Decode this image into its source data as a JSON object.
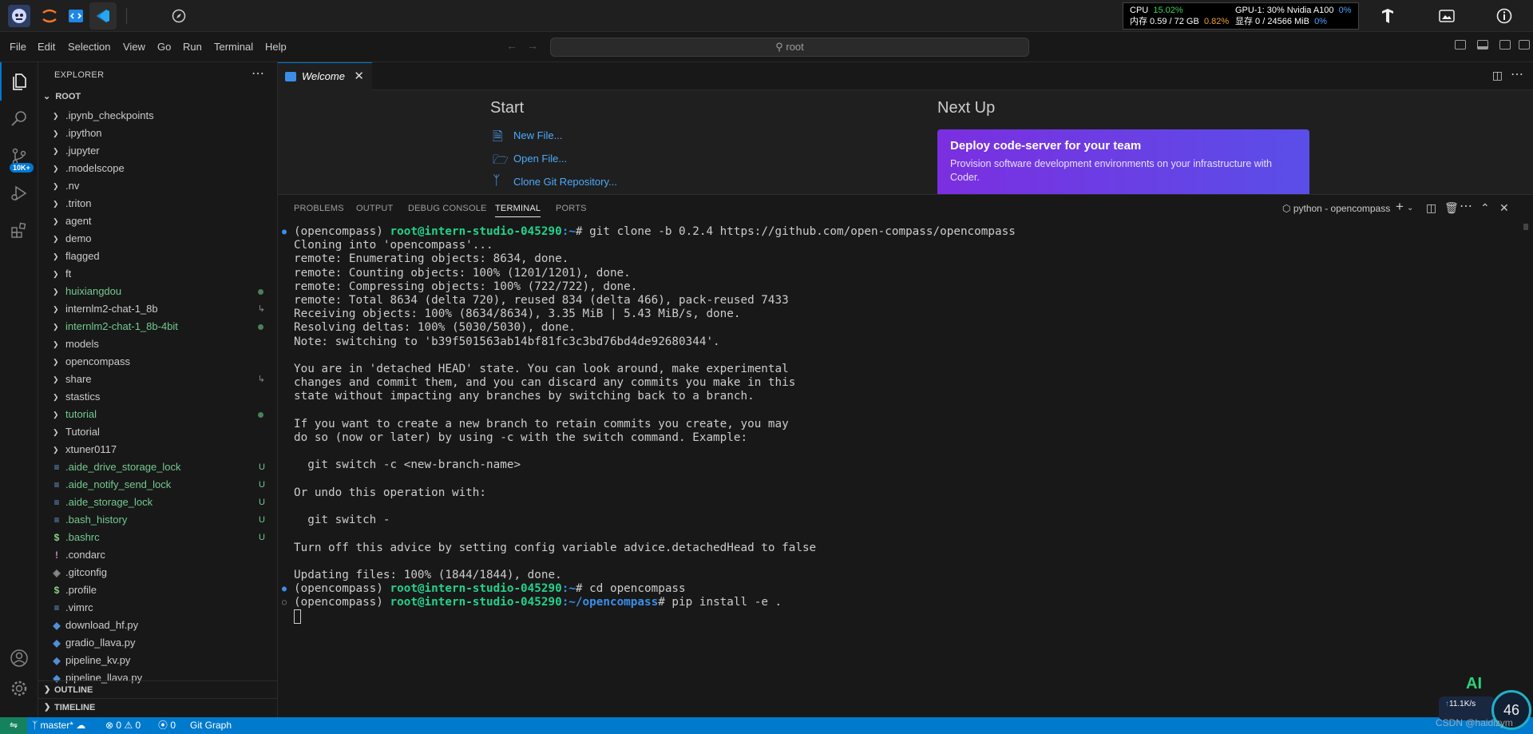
{
  "topbar": {
    "stats": {
      "cpu_label": "CPU",
      "cpu_value": "15.02%",
      "gpu_label": "GPU-1: 30% Nvidia A100",
      "gpu_value": "0%",
      "mem_label": "内存 0.59 / 72 GB",
      "mem_value": "0.82%",
      "vram_label": "显存 0 / 24566 MiB",
      "vram_value": "0%"
    }
  },
  "menubar": {
    "items": [
      "File",
      "Edit",
      "Selection",
      "View",
      "Go",
      "Run",
      "Terminal",
      "Help"
    ],
    "search_placeholder": "root"
  },
  "activity": {
    "badge": "10K+"
  },
  "explorer": {
    "title": "EXPLORER",
    "root": "ROOT",
    "folders": [
      {
        "name": ".ipynb_checkpoints",
        "status": ""
      },
      {
        "name": ".ipython",
        "status": ""
      },
      {
        "name": ".jupyter",
        "status": ""
      },
      {
        "name": ".modelscope",
        "status": ""
      },
      {
        "name": ".nv",
        "status": ""
      },
      {
        "name": ".triton",
        "status": ""
      },
      {
        "name": "agent",
        "status": ""
      },
      {
        "name": "demo",
        "status": ""
      },
      {
        "name": "flagged",
        "status": ""
      },
      {
        "name": "ft",
        "status": ""
      },
      {
        "name": "huixiangdou",
        "status": "dot"
      },
      {
        "name": "internlm2-chat-1_8b",
        "status": "link"
      },
      {
        "name": "internlm2-chat-1_8b-4bit",
        "status": "dot"
      },
      {
        "name": "models",
        "status": ""
      },
      {
        "name": "opencompass",
        "status": ""
      },
      {
        "name": "share",
        "status": "link"
      },
      {
        "name": "stastics",
        "status": ""
      },
      {
        "name": "tutorial",
        "status": "dot"
      },
      {
        "name": "Tutorial",
        "status": ""
      },
      {
        "name": "xtuner0117",
        "status": ""
      }
    ],
    "files": [
      {
        "name": ".aide_drive_storage_lock",
        "badge": "U",
        "icon": "lines"
      },
      {
        "name": ".aide_notify_send_lock",
        "badge": "U",
        "icon": "lines"
      },
      {
        "name": ".aide_storage_lock",
        "badge": "U",
        "icon": "lines"
      },
      {
        "name": ".bash_history",
        "badge": "U",
        "icon": "lines"
      },
      {
        "name": ".bashrc",
        "badge": "U",
        "icon": "dollar"
      },
      {
        "name": ".condarc",
        "badge": "",
        "icon": "bang"
      },
      {
        "name": ".gitconfig",
        "badge": "",
        "icon": "git"
      },
      {
        "name": ".profile",
        "badge": "",
        "icon": "dollar"
      },
      {
        "name": ".vimrc",
        "badge": "",
        "icon": "lines"
      },
      {
        "name": "download_hf.py",
        "badge": "",
        "icon": "python"
      },
      {
        "name": "gradio_llava.py",
        "badge": "",
        "icon": "python"
      },
      {
        "name": "pipeline_kv.py",
        "badge": "",
        "icon": "python"
      },
      {
        "name": "pipeline_llava.py",
        "badge": "",
        "icon": "python"
      }
    ],
    "outline": "OUTLINE",
    "timeline": "TIMELINE"
  },
  "editor": {
    "tab_label": "Welcome",
    "start_heading": "Start",
    "start_links": [
      "New File...",
      "Open File...",
      "Clone Git Repository..."
    ],
    "next_heading": "Next Up",
    "deploy_title": "Deploy code-server for your team",
    "deploy_text": "Provision software development environments on your infrastructure with Coder."
  },
  "panel": {
    "tabs": [
      "PROBLEMS",
      "OUTPUT",
      "DEBUG CONSOLE",
      "TERMINAL",
      "PORTS"
    ],
    "active_tab": "TERMINAL",
    "terminal_name": "python - opencompass"
  },
  "terminal": {
    "env": "(opencompass) ",
    "host": "root@intern-studio-045290",
    "cmd1": "# git clone -b 0.2.4 https://github.com/open-compass/opencompass",
    "output": [
      "Cloning into 'opencompass'...",
      "remote: Enumerating objects: 8634, done.",
      "remote: Counting objects: 100% (1201/1201), done.",
      "remote: Compressing objects: 100% (722/722), done.",
      "remote: Total 8634 (delta 720), reused 834 (delta 466), pack-reused 7433",
      "Receiving objects: 100% (8634/8634), 3.35 MiB | 5.43 MiB/s, done.",
      "Resolving deltas: 100% (5030/5030), done.",
      "Note: switching to 'b39f501563ab14bf81fc3c3bd76bd4de92680344'.",
      "",
      "You are in 'detached HEAD' state. You can look around, make experimental",
      "changes and commit them, and you can discard any commits you make in this",
      "state without impacting any branches by switching back to a branch.",
      "",
      "If you want to create a new branch to retain commits you create, you may",
      "do so (now or later) by using -c with the switch command. Example:",
      "",
      "  git switch -c <new-branch-name>",
      "",
      "Or undo this operation with:",
      "",
      "  git switch -",
      "",
      "Turn off this advice by setting config variable advice.detachedHead to false",
      "",
      "Updating files: 100% (1844/1844), done."
    ],
    "path_root": ":~",
    "cmd2": "# cd opencompass",
    "path_oc": ":~/opencompass",
    "cmd3": "# pip install -e ."
  },
  "statusbar": {
    "branch": "master*",
    "errors": "0",
    "warnings": "0",
    "ports": "0",
    "git_graph": "Git Graph"
  },
  "overlay": {
    "ai": "AI",
    "up": "11.1K/s",
    "percent": "46",
    "watermark": "CSDN @haidizym"
  },
  "colors": {
    "accent": "#007acc",
    "deploy_gradient_start": "#7b2fe0",
    "deploy_gradient_end": "#5a4ee8",
    "host_green": "#23d18b",
    "path_blue": "#3b8eea",
    "git_untracked": "#73c991"
  }
}
